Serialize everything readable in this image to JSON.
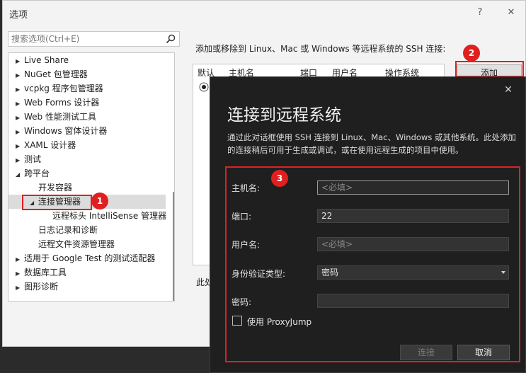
{
  "options_dialog": {
    "title": "选项",
    "help_symbol": "?",
    "close_symbol": "✕",
    "search_placeholder": "搜索选项(Ctrl+E)",
    "tree": [
      {
        "label": "Live Share",
        "arrow": "▶",
        "level": 0
      },
      {
        "label": "NuGet 包管理器",
        "arrow": "▶",
        "level": 0
      },
      {
        "label": "vcpkg 程序包管理器",
        "arrow": "▶",
        "level": 0
      },
      {
        "label": "Web Forms 设计器",
        "arrow": "▶",
        "level": 0
      },
      {
        "label": "Web 性能测试工具",
        "arrow": "▶",
        "level": 0
      },
      {
        "label": "Windows 窗体设计器",
        "arrow": "▶",
        "level": 0
      },
      {
        "label": "XAML 设计器",
        "arrow": "▶",
        "level": 0
      },
      {
        "label": "测试",
        "arrow": "▶",
        "level": 0
      },
      {
        "label": "跨平台",
        "arrow": "◢",
        "level": 0
      },
      {
        "label": "开发容器",
        "arrow": "",
        "level": 1
      },
      {
        "label": "连接管理器",
        "arrow": "◢",
        "level": 1,
        "selected": true
      },
      {
        "label": "远程标头 IntelliSense 管理器",
        "arrow": "",
        "level": 2
      },
      {
        "label": "日志记录和诊断",
        "arrow": "",
        "level": 1
      },
      {
        "label": "远程文件资源管理器",
        "arrow": "",
        "level": 1
      },
      {
        "label": "适用于 Google Test 的测试适配器",
        "arrow": "▶",
        "level": 0
      },
      {
        "label": "数据库工具",
        "arrow": "▶",
        "level": 0
      },
      {
        "label": "图形诊断",
        "arrow": "▶",
        "level": 0
      }
    ],
    "right_label": "添加或移除到 Linux、Mac 或 Windows 等远程系统的 SSH 连接:",
    "table_headers": [
      "默认",
      "主机名",
      "端口",
      "用户名",
      "操作系统"
    ],
    "add_button": "添加",
    "bottom_text": "此处"
  },
  "connect_dialog": {
    "close_symbol": "✕",
    "title": "连接到远程系统",
    "description": "通过此对话框使用 SSH 连接到 Linux、Mac、Windows 或其他系统。此处添加的连接稍后可用于生成或调试，或在使用远程生成的项目中使用。",
    "host_label": "主机名:",
    "host_placeholder": "<必填>",
    "port_label": "端口:",
    "port_value": "22",
    "user_label": "用户名:",
    "user_placeholder": "<必填>",
    "auth_label": "身份验证类型:",
    "auth_value": "密码",
    "password_label": "密码:",
    "proxy_label": "使用 ProxyJump",
    "proxy_checked": false,
    "connect_button": "连接",
    "cancel_button": "取消"
  },
  "annotations": {
    "badge1": "1",
    "badge2": "2",
    "badge3": "3",
    "color": "#e02020"
  }
}
